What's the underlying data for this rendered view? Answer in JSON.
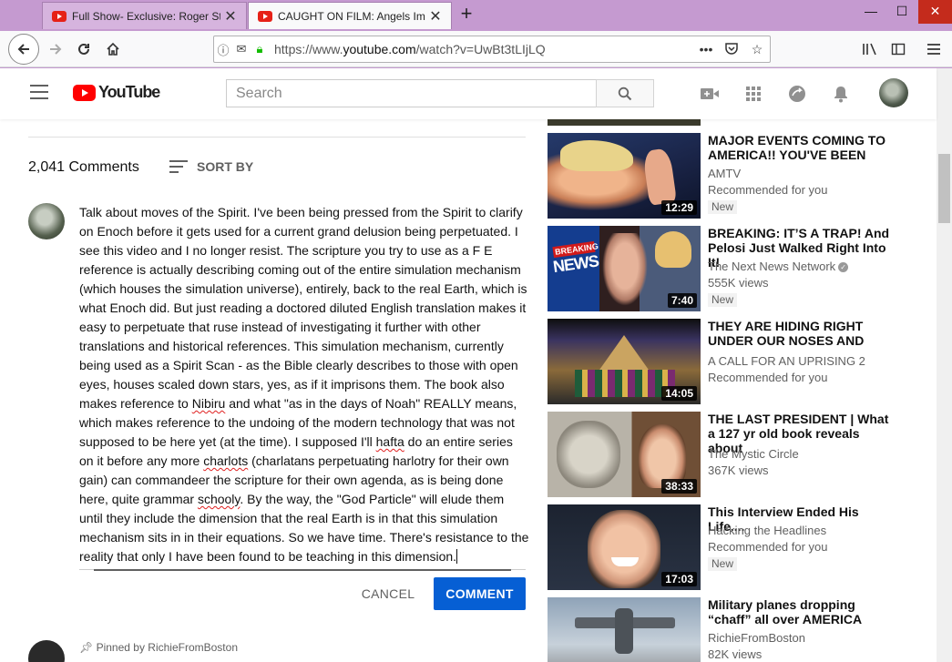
{
  "browser": {
    "tabs": [
      {
        "title": "Full Show- Exclusive: Roger Sto",
        "active": false
      },
      {
        "title": "CAUGHT ON FILM: Angels Imp",
        "active": true
      }
    ],
    "url_prefix": "https://www.",
    "url_host": "youtube.com",
    "url_path": "/watch?v=UwBt3tLIjLQ"
  },
  "yt_header": {
    "logo_text": "YouTube",
    "search_placeholder": "Search"
  },
  "comments": {
    "count": "2,041 Comments",
    "sort_label": "SORT BY",
    "draft_text_segments": [
      "Talk about moves of the Spirit. I've been being pressed from the Spirit to clarify on Enoch before it gets used for a current grand delusion being perpetuated. I see this video and I no longer resist. The scripture you try to use as a F E reference is actually describing coming out of the entire simulation mechanism (which houses the simulation universe), entirely, back to the real Earth, which is what Enoch did. But just reading a doctored diluted English translation makes it easy to perpetuate that ruse instead of investigating it further with other translations and historical references. This simulation mechanism, currently being used as a Spirit Scan - as the Bible clearly describes to those with open eyes, houses scaled down stars, yes, as if it imprisons them. The book also makes reference to ",
      "Nibiru",
      " and what \"as in the days of Noah\" REALLY means, which makes reference to the undoing of the modern technology that was not supposed to be here yet (at the time). I supposed I'll ",
      "hafta",
      " do an entire series on it before any more ",
      "charlots",
      " (charlatans perpetuating harlotry for their own gain) can commandeer the scripture for their own agenda, as is being done here, quite grammar ",
      "schooly",
      ". By the way, the \"God Particle\" will elude them until they include the dimension that the real Earth is in that this simulation mechanism sits in in their equations. So we have time. There's resistance to the reality that only I have been found to be teaching in this dimension."
    ],
    "cancel_label": "CANCEL",
    "comment_label": "COMMENT",
    "pinned_text": "Pinned by RichieFromBoston"
  },
  "sidebar": [
    {
      "title": "MAJOR EVENTS COMING TO AMERICA!! YOU'VE BEEN",
      "channel": "AMTV",
      "line2": "Recommended for you",
      "badge": "New",
      "duration": "12:29"
    },
    {
      "title": "BREAKING: IT’S A TRAP! And Pelosi Just Walked Right Into It!",
      "channel": "The Next News Network",
      "line2": "555K views",
      "badge": "New",
      "duration": "7:40",
      "thumb_text_1": "BREAKING",
      "thumb_text_2": "NEWS"
    },
    {
      "title": "THEY ARE HIDING RIGHT UNDER OUR NOSES AND",
      "channel": "A CALL FOR AN UPRISING 2",
      "line2": "Recommended for you",
      "badge": "",
      "duration": "14:05"
    },
    {
      "title": "THE LAST PRESIDENT | What a 127 yr old book reveals about",
      "channel": "The Mystic Circle",
      "line2": "367K views",
      "badge": "",
      "duration": "38:33"
    },
    {
      "title": "This Interview Ended His Life....",
      "channel": "Hacking the Headlines",
      "line2": "Recommended for you",
      "badge": "New",
      "duration": "17:03"
    },
    {
      "title": "Military planes dropping “chaff” all over AMERICA",
      "channel": "RichieFromBoston",
      "line2": "82K views",
      "badge": "",
      "duration": ""
    }
  ],
  "colors": {
    "accent": "#065fd4",
    "brand": "#ff0000",
    "frame": "#c59ad0"
  }
}
